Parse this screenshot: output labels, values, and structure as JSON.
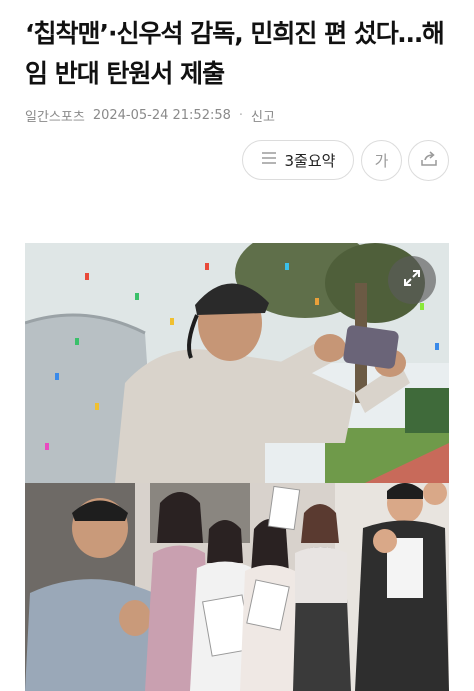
{
  "article": {
    "headline": "‘칩착맨’·신우석 감독, 민희진 편 섰다…해임 반대 탄원서 제출",
    "source": "일간스포츠",
    "timestamp": "2024-05-24 21:52:58",
    "report_label": "신고"
  },
  "toolbar": {
    "summary_label": "3줄요약",
    "font_label": "가",
    "icons": [
      "summary-lines-icon",
      "share-icon",
      "expand-icon"
    ]
  },
  "colors": {
    "headline": "#111111",
    "meta": "#8a8a8a",
    "border": "#dcdcdc"
  }
}
